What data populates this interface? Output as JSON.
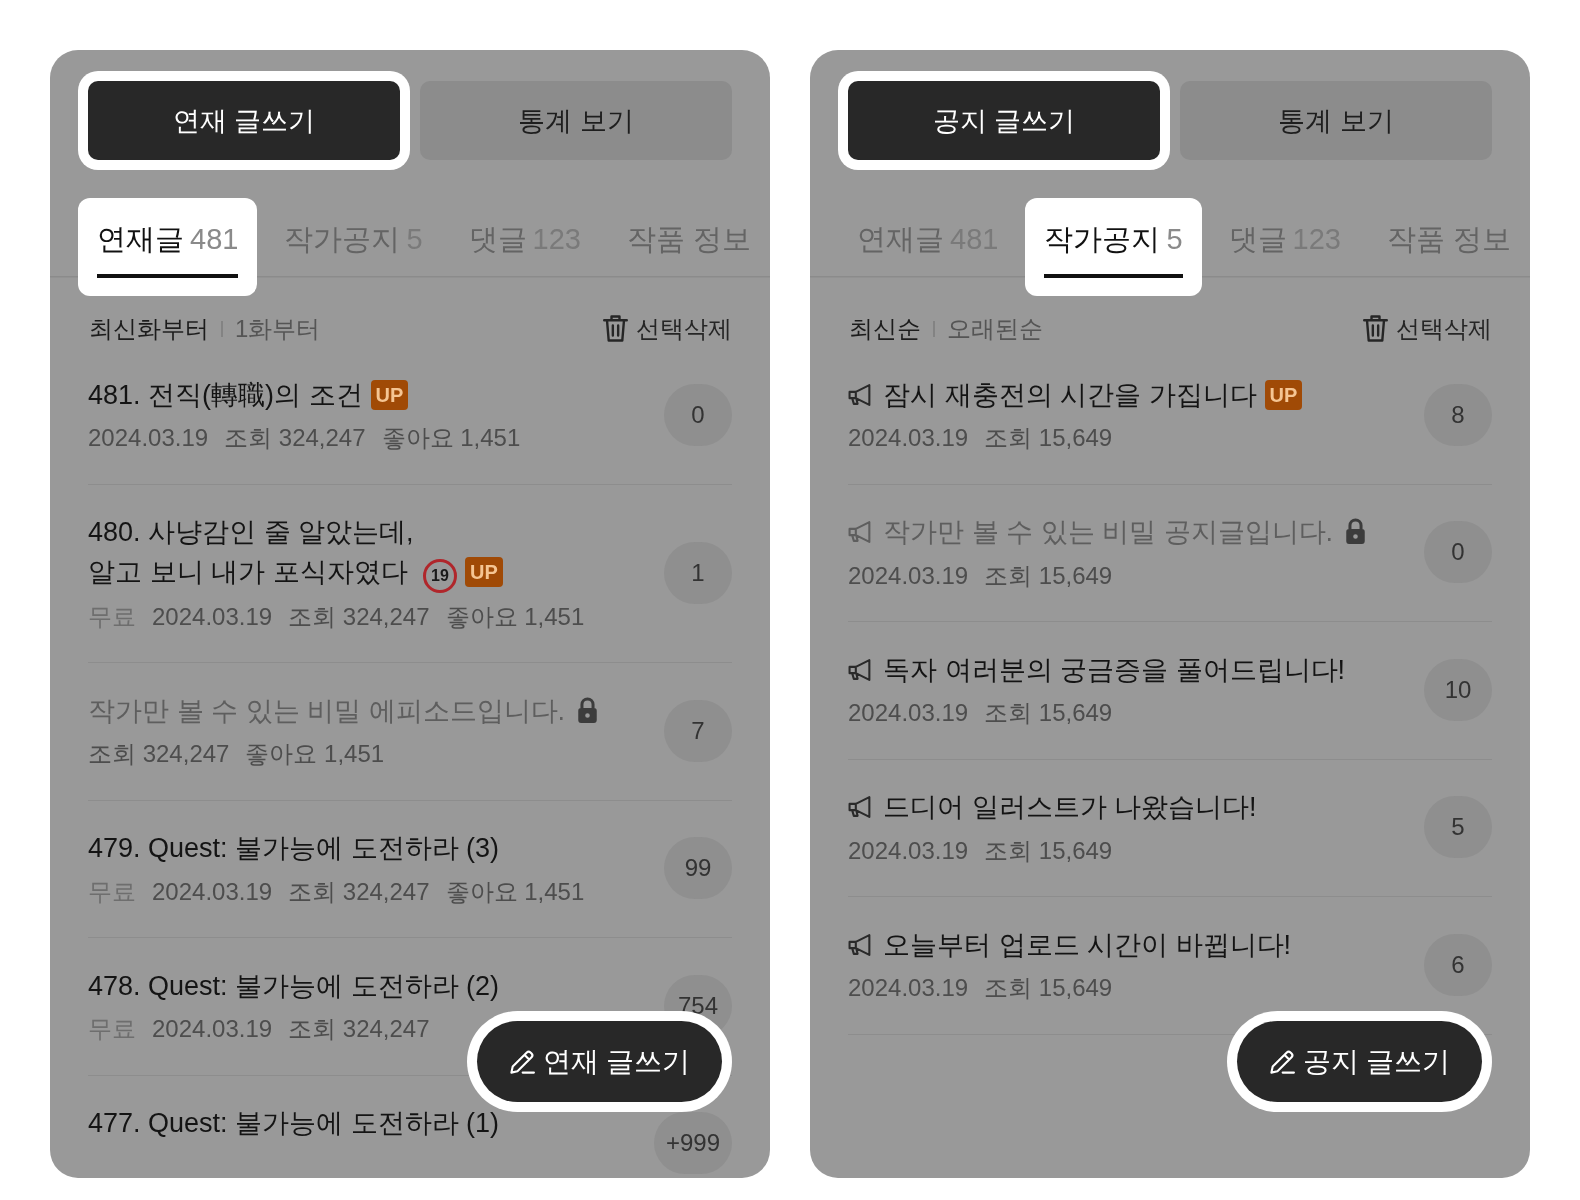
{
  "panels": [
    {
      "action_buttons": [
        {
          "label": "연재 글쓰기",
          "kind": "primary",
          "highlighted": true
        },
        {
          "label": "통계 보기",
          "kind": "secondary",
          "highlighted": false
        }
      ],
      "tabs": [
        {
          "label": "연재글",
          "count": "481",
          "selected": true
        },
        {
          "label": "작가공지",
          "count": "5",
          "selected": false
        },
        {
          "label": "댓글",
          "count": "123",
          "selected": false
        },
        {
          "label": "작품 정보",
          "selected": false
        }
      ],
      "sort_options": [
        {
          "label": "최신화부터",
          "selected": true
        },
        {
          "label": "1화부터",
          "selected": false
        }
      ],
      "delete_button": {
        "label": "선택삭제"
      },
      "posts": [
        {
          "kind": "episode",
          "title": "481. 전직(轉職)의 조건",
          "badges": [
            {
              "kind": "up",
              "text": "UP"
            }
          ],
          "locked": false,
          "date": "2024.03.19",
          "views": "조회 324,247",
          "likes": "좋아요 1,451",
          "comments": "0"
        },
        {
          "kind": "episode",
          "title": "480. 사냥감인 줄 알았는데, 알고 보니 내가 포식자였다",
          "badges": [
            {
              "kind": "age",
              "text": "19"
            },
            {
              "kind": "up",
              "text": "UP"
            }
          ],
          "locked": false,
          "price": "무료",
          "date": "2024.03.19",
          "views": "조회 324,247",
          "likes": "좋아요 1,451",
          "comments": "1"
        },
        {
          "kind": "episode",
          "title": "작가만 볼 수 있는 비밀 에피소드입니다.",
          "locked": true,
          "views": "조회 324,247",
          "likes": "좋아요 1,451",
          "comments": "7"
        },
        {
          "kind": "episode",
          "title": "479. Quest: 불가능에 도전하라 (3)",
          "locked": false,
          "price": "무료",
          "date": "2024.03.19",
          "views": "조회 324,247",
          "likes": "좋아요 1,451",
          "comments": "99"
        },
        {
          "kind": "episode",
          "title": "478. Quest: 불가능에 도전하라 (2)",
          "locked": false,
          "price": "무료",
          "date": "2024.03.19",
          "views": "조회 324,247",
          "comments": "754"
        },
        {
          "kind": "episode",
          "title": "477. Quest: 불가능에 도전하라 (1)",
          "locked": false,
          "comments": "+999"
        }
      ],
      "fab": {
        "label": "연재 글쓰기",
        "highlighted": true
      }
    },
    {
      "action_buttons": [
        {
          "label": "공지 글쓰기",
          "kind": "primary",
          "highlighted": true
        },
        {
          "label": "통계 보기",
          "kind": "secondary",
          "highlighted": false
        }
      ],
      "tabs": [
        {
          "label": "연재글",
          "count": "481",
          "selected": false
        },
        {
          "label": "작가공지",
          "count": "5",
          "selected": true
        },
        {
          "label": "댓글",
          "count": "123",
          "selected": false
        },
        {
          "label": "작품 정보",
          "selected": false
        }
      ],
      "sort_options": [
        {
          "label": "최신순",
          "selected": true
        },
        {
          "label": "오래된순",
          "selected": false
        }
      ],
      "delete_button": {
        "label": "선택삭제"
      },
      "posts": [
        {
          "kind": "notice",
          "title": "잠시 재충전의 시간을 가집니다",
          "badges": [
            {
              "kind": "up",
              "text": "UP"
            }
          ],
          "locked": false,
          "date": "2024.03.19",
          "views": "조회 15,649",
          "comments": "8"
        },
        {
          "kind": "notice",
          "title": "작가만 볼 수 있는 비밀 공지글입니다.",
          "locked": true,
          "date": "2024.03.19",
          "views": "조회 15,649",
          "comments": "0"
        },
        {
          "kind": "notice",
          "title": "독자 여러분의 궁금증을 풀어드립니다!",
          "locked": false,
          "date": "2024.03.19",
          "views": "조회 15,649",
          "comments": "10"
        },
        {
          "kind": "notice",
          "title": "드디어 일러스트가 나왔습니다!",
          "locked": false,
          "date": "2024.03.19",
          "views": "조회 15,649",
          "comments": "5"
        },
        {
          "kind": "notice",
          "title": "오늘부터 업로드 시간이 바뀝니다!",
          "locked": false,
          "date": "2024.03.19",
          "views": "조회 15,649",
          "comments": "6"
        }
      ],
      "fab": {
        "label": "공지 글쓰기",
        "highlighted": true
      }
    }
  ]
}
